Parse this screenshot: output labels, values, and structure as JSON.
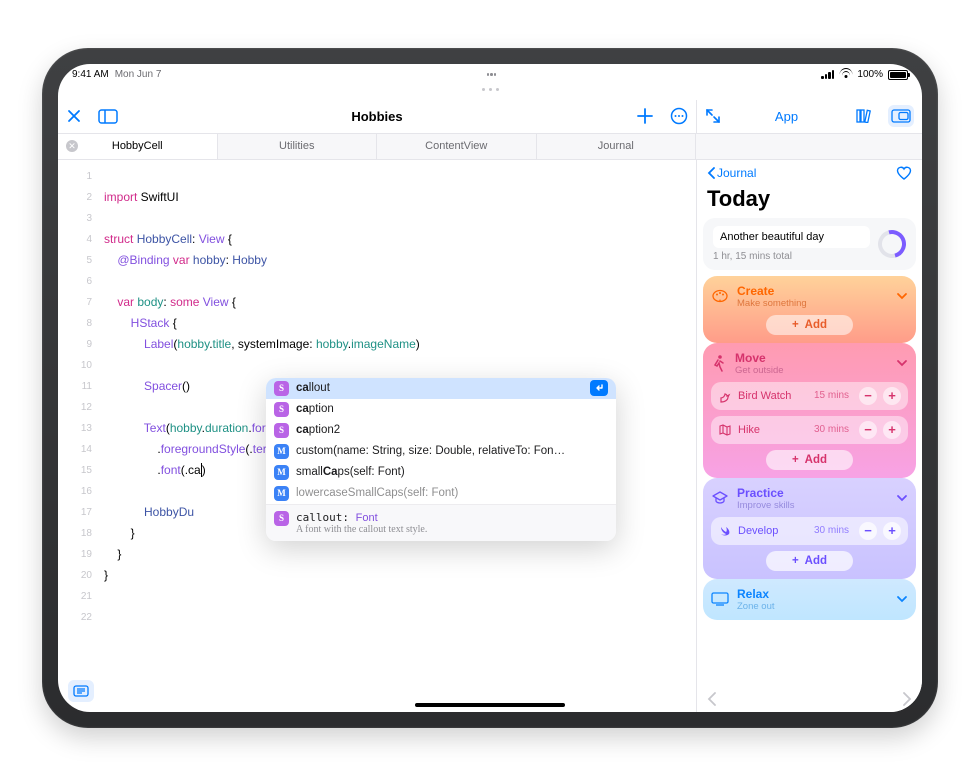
{
  "status": {
    "time": "9:41 AM",
    "date": "Mon Jun 7",
    "battery": "100%"
  },
  "toolbar": {
    "title": "Hobbies",
    "preview_title": "App"
  },
  "tabs": [
    "HobbyCell",
    "Utilities",
    "ContentView",
    "Journal"
  ],
  "code": {
    "lines": [
      {
        "n": 1,
        "html": ""
      },
      {
        "n": 2,
        "html": "<span class='pink'>import</span> SwiftUI"
      },
      {
        "n": 3,
        "html": ""
      },
      {
        "n": 4,
        "html": "<span class='pink'>struct</span> <span class='bd'>HobbyCell</span>: <span class='purple'>View</span> {"
      },
      {
        "n": 5,
        "html": "    <span class='purple'>@Binding</span> <span class='pink'>var</span> <span class='bd'>hobby</span>: <span class='bd'>Hobby</span>"
      },
      {
        "n": 6,
        "html": ""
      },
      {
        "n": 7,
        "html": "    <span class='pink'>var</span> <span class='teal'>body</span>: <span class='pink'>some</span> <span class='purple'>View</span> {"
      },
      {
        "n": 8,
        "html": "        <span class='purple'>HStack</span> {"
      },
      {
        "n": 9,
        "html": "            <span class='purple'>Label</span>(<span class='teal'>hobby</span>.<span class='teal'>title</span>, systemImage: <span class='teal'>hobby</span>.<span class='teal'>imageName</span>)"
      },
      {
        "n": 10,
        "html": ""
      },
      {
        "n": 11,
        "html": "            <span class='purple'>Spacer</span>()"
      },
      {
        "n": 12,
        "html": ""
      },
      {
        "n": 13,
        "html": "            <span class='purple'>Text</span>(<span class='teal'>hobby</span>.<span class='teal'>duration</span>.<span class='purple'>formatted</span>())"
      },
      {
        "n": 14,
        "html": "                .<span class='purple'>foregroundStyle</span>(.<span class='purple'>tertiary</span>)"
      },
      {
        "n": 15,
        "html": "                .<span class='purple'>font</span>(.ca<span style='border-left:1px solid #000'></span>)"
      },
      {
        "n": 16,
        "html": ""
      },
      {
        "n": 17,
        "html": "            <span class='bd'>HobbyDu</span>"
      },
      {
        "n": 18,
        "html": "        }"
      },
      {
        "n": 19,
        "html": "    }"
      },
      {
        "n": 20,
        "html": "}"
      },
      {
        "n": 21,
        "html": ""
      },
      {
        "n": 22,
        "html": ""
      }
    ]
  },
  "autocomplete": {
    "items": [
      {
        "k": "S",
        "sel": true,
        "pre": "ca",
        "rest": "llout"
      },
      {
        "k": "S",
        "pre": "ca",
        "rest": "ption"
      },
      {
        "k": "S",
        "pre": "ca",
        "rest": "ption2"
      },
      {
        "k": "M",
        "raw": "custom(name: String, size: Double, relativeTo: Fon…"
      },
      {
        "k": "M",
        "raw": "small",
        "bold": "Ca",
        "tail": "ps(self: Font)"
      },
      {
        "k": "M",
        "raw": "lowercaseSmallCaps(self: Font)",
        "dim": true
      }
    ],
    "doc_title": "callout: Font",
    "doc_sub": "A font with the callout text style."
  },
  "preview": {
    "back": "Journal",
    "title": "Today",
    "summary_text": "Another beautiful day",
    "summary_sub": "1 hr, 15 mins total",
    "add": "Add",
    "cards": [
      {
        "id": "create",
        "title": "Create",
        "sub": "Make something",
        "acts": []
      },
      {
        "id": "move",
        "title": "Move",
        "sub": "Get outside",
        "acts": [
          {
            "icon": "bird",
            "name": "Bird Watch",
            "dur": "15 mins"
          },
          {
            "icon": "map",
            "name": "Hike",
            "dur": "30 mins"
          }
        ]
      },
      {
        "id": "practice",
        "title": "Practice",
        "sub": "Improve skills",
        "acts": [
          {
            "icon": "swift",
            "name": "Develop",
            "dur": "30 mins"
          }
        ]
      },
      {
        "id": "relax",
        "title": "Relax",
        "sub": "Zone out",
        "acts": []
      }
    ]
  }
}
